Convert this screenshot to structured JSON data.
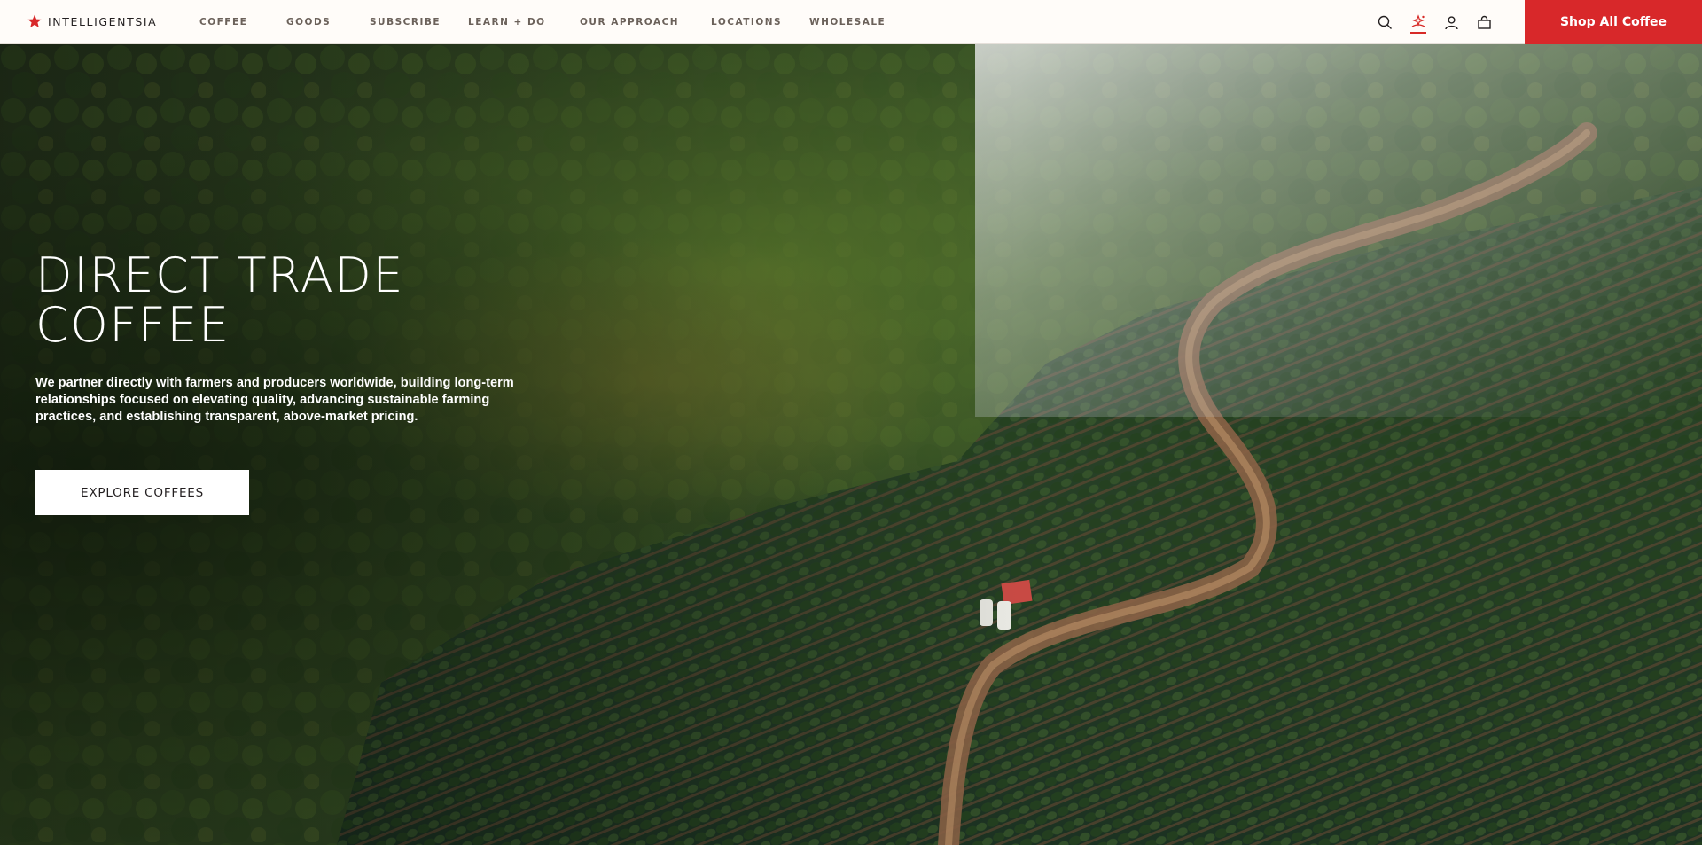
{
  "brand": {
    "name": "INTELLIGENTSIA",
    "logo_icon": "star-icon",
    "accent_color": "#d8282a"
  },
  "nav": {
    "items": [
      {
        "label": "COFFEE"
      },
      {
        "label": "GOODS"
      },
      {
        "label": "SUBSCRIBE"
      },
      {
        "label": "LEARN + DO"
      },
      {
        "label": "OUR APPROACH"
      },
      {
        "label": "LOCATIONS"
      },
      {
        "label": "WHOLESALE"
      }
    ]
  },
  "header_icons": [
    "search-icon",
    "ai-assistant-icon",
    "account-icon",
    "cart-icon"
  ],
  "shop_button": {
    "label": "Shop All Coffee"
  },
  "hero": {
    "title": "DIRECT TRADE COFFEE",
    "body": "We partner directly with farmers and producers worldwide, building long-term relationships focused on elevating quality, advancing sustainable farming practices, and establishing transparent, above-market pricing.",
    "cta_label": "EXPLORE COFFEES"
  }
}
